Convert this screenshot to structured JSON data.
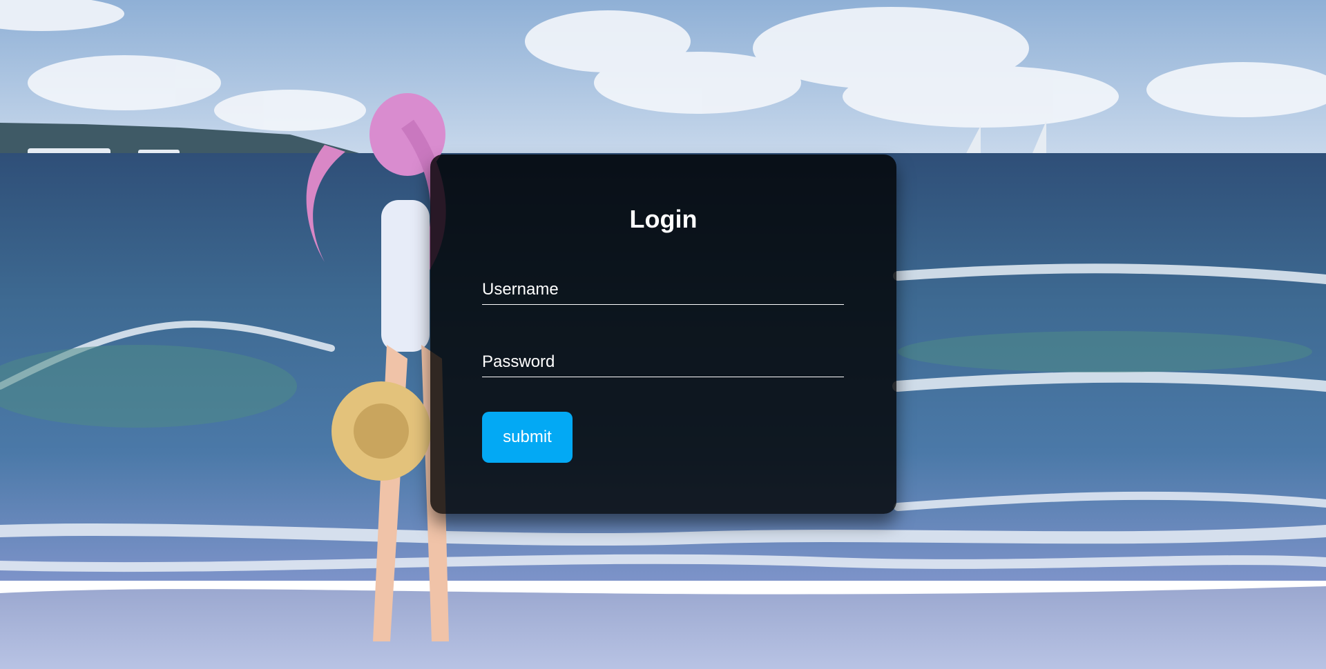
{
  "background": {
    "description_icon": "beach-ocean-artwork",
    "colors": {
      "sky": "#9fb8d8",
      "ocean": "#3e6a92",
      "foam": "#e8eef6",
      "sand": "#a9b8dc"
    }
  },
  "login": {
    "title": "Login",
    "username_label": "Username",
    "password_label": "Password",
    "submit_label": "submit",
    "panel_color": "#000000",
    "accent_color": "#03a9f4"
  }
}
